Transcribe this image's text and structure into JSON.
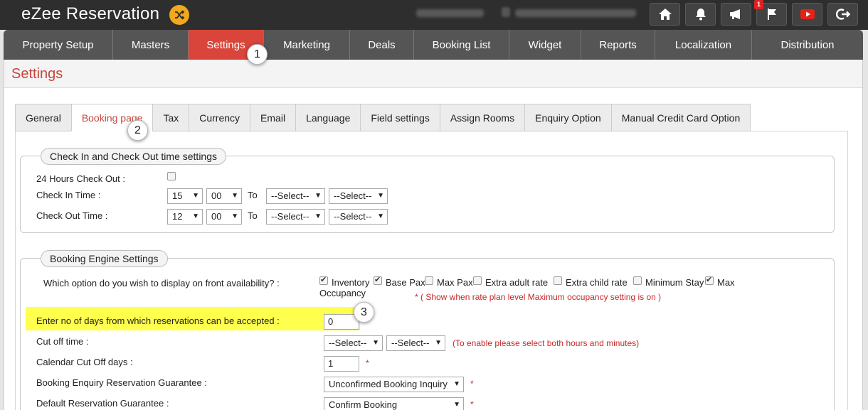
{
  "header": {
    "app_title": "eZee Reservation",
    "icons": [
      "shuffle-icon",
      "home-icon",
      "bell-icon",
      "megaphone-icon",
      "flag-icon",
      "youtube-icon",
      "logout-icon"
    ],
    "notification_count": "1",
    "accent_color": "#f2a81d"
  },
  "nav": {
    "items": [
      {
        "label": "Property Setup"
      },
      {
        "label": "Masters"
      },
      {
        "label": "Settings"
      },
      {
        "label": "Marketing"
      },
      {
        "label": "Deals"
      },
      {
        "label": "Booking List"
      },
      {
        "label": "Widget"
      },
      {
        "label": "Reports"
      },
      {
        "label": "Localization"
      },
      {
        "label": "Distribution"
      }
    ],
    "active_index": 2,
    "active_color": "#d9453a"
  },
  "page": {
    "title": "Settings",
    "title_color": "#c9453a"
  },
  "subtabs": {
    "items": [
      {
        "label": "General"
      },
      {
        "label": "Booking page"
      },
      {
        "label": "Tax"
      },
      {
        "label": "Currency"
      },
      {
        "label": "Email"
      },
      {
        "label": "Language"
      },
      {
        "label": "Field settings"
      },
      {
        "label": "Assign Rooms"
      },
      {
        "label": "Enquiry Option"
      },
      {
        "label": "Manual Credit Card Option"
      }
    ],
    "active_index": 1
  },
  "checkin_section": {
    "legend": "Check In and Check Out time settings",
    "hours24_label": "24 Hours Check Out :",
    "hours24_checked": false,
    "checkin_label": "Check In Time :",
    "checkin_hour": "15",
    "checkin_minute": "00",
    "checkin_to": "To",
    "checkin_to_hour": "--Select--",
    "checkin_to_minute": "--Select--",
    "checkout_label": "Check Out Time :",
    "checkout_hour": "12",
    "checkout_minute": "00",
    "checkout_to": "To",
    "checkout_to_hour": "--Select--",
    "checkout_to_minute": "--Select--"
  },
  "engine_section": {
    "legend": "Booking Engine Settings",
    "display_question": "Which option do you wish to display on front availability? :",
    "options": [
      {
        "label": "Inventory",
        "checked": true
      },
      {
        "label": "Base Pax",
        "checked": true
      },
      {
        "label": "Max Pax",
        "checked": false
      },
      {
        "label": "Extra adult rate",
        "checked": false
      },
      {
        "label": "Extra child rate",
        "checked": false
      },
      {
        "label": "Minimum Stay",
        "checked": false
      },
      {
        "label": "Max",
        "checked": true
      }
    ],
    "option_wrap_text": "Occupancy",
    "max_occupancy_note": "* ( Show when rate plan level Maximum occupancy setting is on )",
    "days_label": "Enter no of days from which reservations can be accepted :",
    "days_value": "0",
    "cutoff_label": "Cut off time :",
    "cutoff_hour": "--Select--",
    "cutoff_minute": "--Select--",
    "cutoff_note": "(To enable please select both hours and minutes)",
    "calendar_cutoff_label": "Calendar Cut Off days :",
    "calendar_cutoff_value": "1",
    "required_mark": "*",
    "enquiry_guarantee_label": "Booking Enquiry Reservation Guarantee :",
    "enquiry_guarantee_value": "Unconfirmed Booking Inquiry",
    "default_guarantee_label": "Default Reservation Guarantee :",
    "default_guarantee_value": "Confirm Booking",
    "highlight_color": "#ffff4d"
  },
  "callouts": [
    "1",
    "2",
    "3"
  ]
}
